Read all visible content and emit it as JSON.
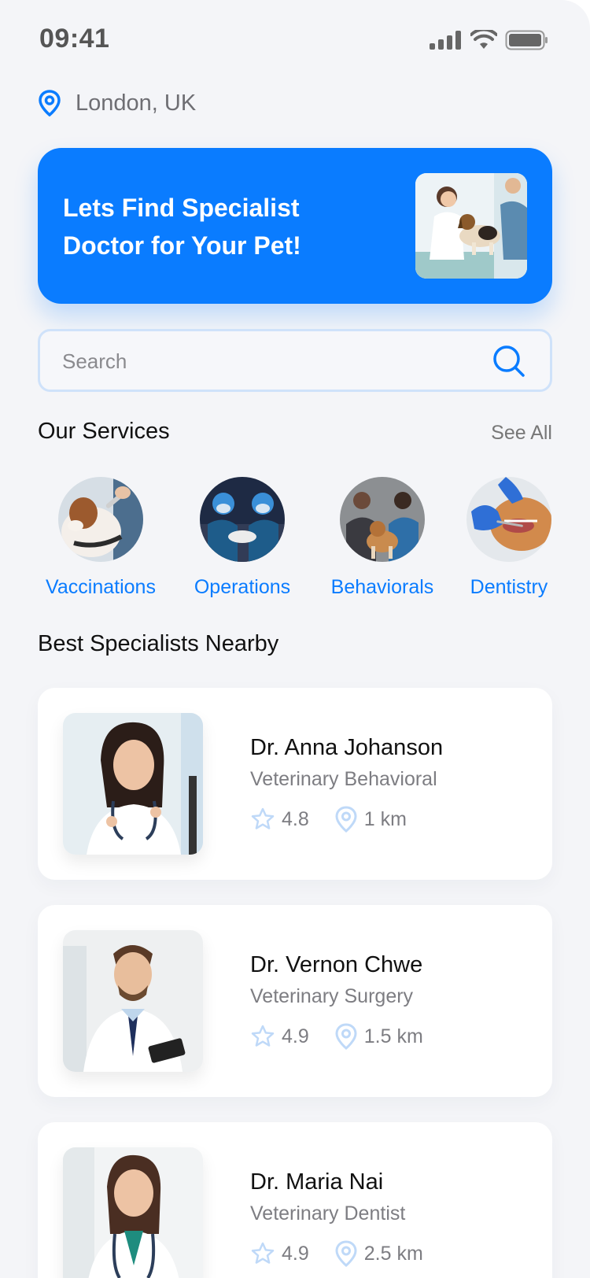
{
  "status": {
    "time": "09:41"
  },
  "location": {
    "text": "London, UK"
  },
  "hero": {
    "title": "Lets Find Specialist Doctor for Your Pet!"
  },
  "search": {
    "placeholder": "Search"
  },
  "services": {
    "title": "Our Services",
    "see_all": "See All",
    "items": [
      {
        "label": "Vaccinations"
      },
      {
        "label": "Operations"
      },
      {
        "label": "Behaviorals"
      },
      {
        "label": "Dentistry"
      }
    ]
  },
  "specialists": {
    "title": "Best Specialists Nearby",
    "doctors": [
      {
        "name": "Dr. Anna Johanson",
        "specialty": "Veterinary Behavioral",
        "rating": "4.8",
        "distance": "1 km"
      },
      {
        "name": "Dr. Vernon Chwe",
        "specialty": "Veterinary Surgery",
        "rating": "4.9",
        "distance": "1.5 km"
      },
      {
        "name": "Dr. Maria Nai",
        "specialty": "Veterinary Dentist",
        "rating": "4.9",
        "distance": "2.5 km"
      }
    ]
  },
  "colors": {
    "accent": "#0A7CFF",
    "background": "#F4F5F8",
    "card": "#FFFFFF"
  }
}
